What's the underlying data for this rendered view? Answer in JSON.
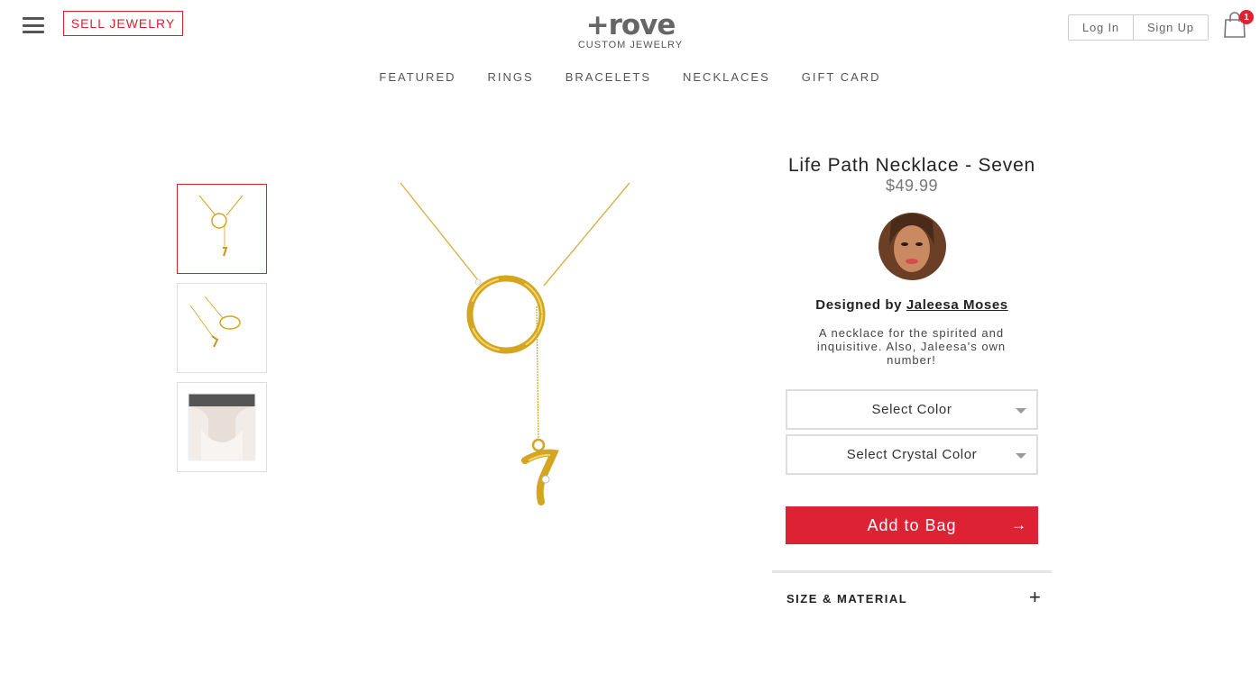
{
  "header": {
    "sell_label": "SELL JEWELRY",
    "logo_word": "+rove",
    "logo_sub": "CUSTOM JEWELRY",
    "login_label": "Log In",
    "signup_label": "Sign Up",
    "cart_count": "1"
  },
  "nav": {
    "items": [
      "FEATURED",
      "RINGS",
      "BRACELETS",
      "NECKLACES",
      "GIFT CARD"
    ]
  },
  "product": {
    "title": "Life Path Necklace - Seven",
    "price": "$49.99",
    "designed_prefix": "Designed by",
    "designer": "Jaleesa Moses",
    "description": "A necklace for the spirited and inquisitive. Also, Jaleesa's own number!",
    "select_color": "Select Color",
    "select_crystal": "Select Crystal Color",
    "add_to_bag": "Add to Bag",
    "arrow": "→",
    "size_material": "SIZE & MATERIAL",
    "expand_symbol": "+"
  },
  "colors": {
    "brand_red": "#dd2233",
    "gold": "#d4a520"
  }
}
